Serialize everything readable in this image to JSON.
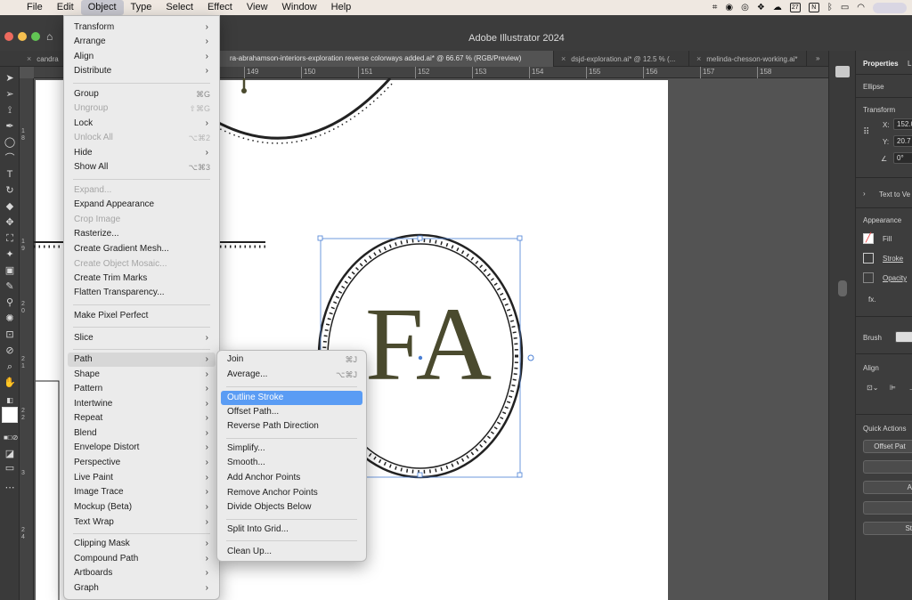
{
  "menubar": {
    "apple": "",
    "items": [
      "File",
      "Edit",
      "Object",
      "Type",
      "Select",
      "Effect",
      "View",
      "Window",
      "Help"
    ],
    "active": "Object",
    "calendar_day": "27",
    "notion": "N"
  },
  "window": {
    "title": "Adobe Illustrator 2024"
  },
  "tabs": [
    "candra",
    "ra-abrahamson-interiors-exploration reverse colorways added.ai* @ 66.67 % (RGB/Preview)",
    "dsjd-exploration.ai* @ 12.5 % (...",
    "melinda-chesson-working.ai*"
  ],
  "tabs_more": "»",
  "ruler": {
    "ticks": [
      "149",
      "150",
      "151",
      "152",
      "153",
      "154",
      "155",
      "156",
      "157",
      "158"
    ]
  },
  "vruler": [
    "1",
    "8",
    "1",
    "9",
    "2",
    "0",
    "2",
    "1",
    "2",
    "2",
    "3",
    "2",
    "4"
  ],
  "artwork": {
    "monogram": "FA"
  },
  "object_menu": {
    "items": [
      {
        "label": "Transform",
        "submenu": true
      },
      {
        "label": "Arrange",
        "submenu": true
      },
      {
        "label": "Align",
        "submenu": true
      },
      {
        "label": "Distribute",
        "submenu": true
      },
      {
        "label": "Group",
        "shortcut": "⌘G"
      },
      {
        "label": "Ungroup",
        "shortcut": "⇧⌘G",
        "disabled": true
      },
      {
        "label": "Lock",
        "submenu": true
      },
      {
        "label": "Unlock All",
        "shortcut": "⌥⌘2",
        "disabled": true
      },
      {
        "label": "Hide",
        "submenu": true
      },
      {
        "label": "Show All",
        "shortcut": "⌥⌘3"
      },
      {
        "label": "Expand...",
        "disabled": true
      },
      {
        "label": "Expand Appearance"
      },
      {
        "label": "Crop Image",
        "disabled": true
      },
      {
        "label": "Rasterize..."
      },
      {
        "label": "Create Gradient Mesh..."
      },
      {
        "label": "Create Object Mosaic...",
        "disabled": true
      },
      {
        "label": "Create Trim Marks"
      },
      {
        "label": "Flatten Transparency..."
      },
      {
        "label": "Make Pixel Perfect"
      },
      {
        "label": "Slice",
        "submenu": true
      },
      {
        "label": "Path",
        "submenu": true,
        "open": true
      },
      {
        "label": "Shape",
        "submenu": true
      },
      {
        "label": "Pattern",
        "submenu": true
      },
      {
        "label": "Intertwine",
        "submenu": true
      },
      {
        "label": "Repeat",
        "submenu": true
      },
      {
        "label": "Blend",
        "submenu": true
      },
      {
        "label": "Envelope Distort",
        "submenu": true
      },
      {
        "label": "Perspective",
        "submenu": true
      },
      {
        "label": "Live Paint",
        "submenu": true
      },
      {
        "label": "Image Trace",
        "submenu": true
      },
      {
        "label": "Mockup (Beta)",
        "submenu": true
      },
      {
        "label": "Text Wrap",
        "submenu": true
      },
      {
        "label": "Clipping Mask",
        "submenu": true
      },
      {
        "label": "Compound Path",
        "submenu": true
      },
      {
        "label": "Artboards",
        "submenu": true
      },
      {
        "label": "Graph",
        "submenu": true
      }
    ]
  },
  "path_menu": {
    "items": [
      {
        "label": "Join",
        "shortcut": "⌘J"
      },
      {
        "label": "Average...",
        "shortcut": "⌥⌘J"
      },
      {
        "label": "Outline Stroke",
        "highlighted": true
      },
      {
        "label": "Offset Path..."
      },
      {
        "label": "Reverse Path Direction"
      },
      {
        "label": "Simplify..."
      },
      {
        "label": "Smooth..."
      },
      {
        "label": "Add Anchor Points"
      },
      {
        "label": "Remove Anchor Points"
      },
      {
        "label": "Divide Objects Below"
      },
      {
        "label": "Split Into Grid..."
      },
      {
        "label": "Clean Up..."
      }
    ]
  },
  "properties": {
    "tab": "Properties",
    "tab2": "L",
    "object_type": "Ellipse",
    "transform_title": "Transform",
    "x_label": "X:",
    "x_value": "152.0",
    "y_label": "Y:",
    "y_value": "20.7",
    "angle_value": "0°",
    "text_to_vector": "Text to Ve",
    "appearance_title": "Appearance",
    "fill": "Fill",
    "stroke": "Stroke",
    "opacity": "Opacity",
    "fx": "fx.",
    "brush": "Brush",
    "align_title": "Align",
    "quick_actions_title": "Quick Actions",
    "offset_path_btn": "Offset Pat",
    "btn_a": "A",
    "btn_s": "St"
  },
  "colors": {
    "accent_highlight": "#5a9cf4",
    "monogram_fill": "#4a4a2e",
    "selection_blue": "#4a7fd4",
    "close": "#ed6a5e",
    "minimize": "#f5bf4f",
    "zoom": "#62c554"
  }
}
